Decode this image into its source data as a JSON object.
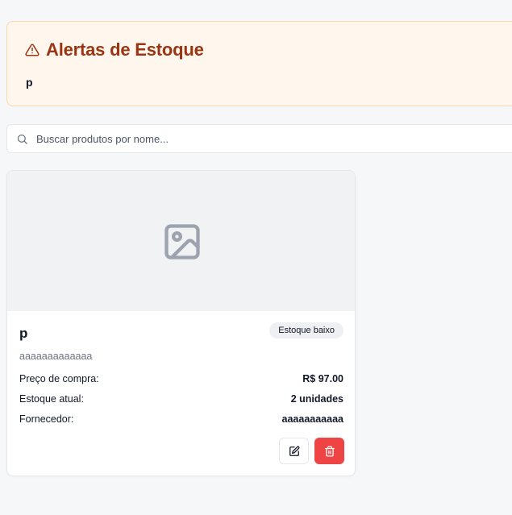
{
  "alerts": {
    "title": "Alertas de Estoque",
    "items": [
      "p"
    ]
  },
  "search": {
    "placeholder": "Buscar produtos por nome...",
    "value": ""
  },
  "products": [
    {
      "name": "p",
      "badge": "Estoque baixo",
      "description": "aaaaaaaaaaaaa",
      "price_label": "Preço de compra:",
      "price_value": "R$ 97.00",
      "stock_label": "Estoque atual:",
      "stock_value": "2 unidades",
      "supplier_label": "Fornecedor:",
      "supplier_value": "aaaaaaaaaaa",
      "image_icon": "image-placeholder-icon",
      "actions": {
        "edit_icon": "edit-icon",
        "delete_icon": "trash-icon"
      }
    }
  ],
  "colors": {
    "alert_bg": "#fff7ed",
    "alert_border": "#fed7aa",
    "alert_title": "#9a3412",
    "delete_button": "#ef4444",
    "page_bg": "#f6f7f9"
  }
}
